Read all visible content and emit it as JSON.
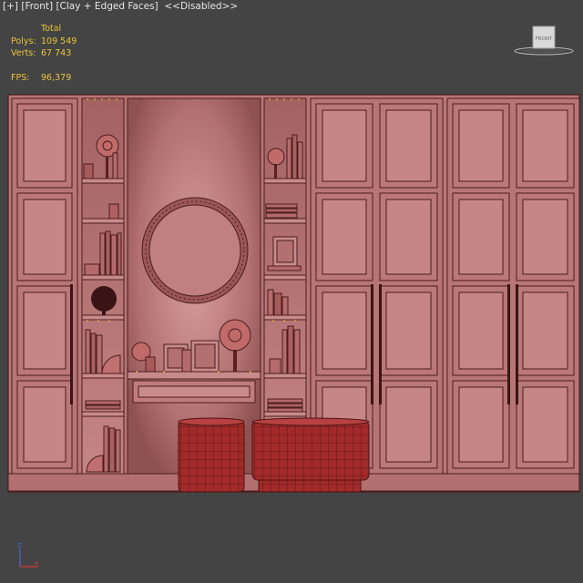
{
  "viewport": {
    "label_plus": "[+]",
    "label_view": "[Front]",
    "label_shading": "[Clay + Edged Faces]",
    "label_disabled": "<<Disabled>>"
  },
  "stats": {
    "total_label": "Total",
    "polys_label": "Polys:",
    "polys_value": "109 549",
    "verts_label": "Verts:",
    "verts_value": "67 743",
    "fps_label": "FPS:",
    "fps_value": "96,379"
  },
  "viewcube": {
    "face_label": "FRONT"
  },
  "axis": {
    "z_label": "Z",
    "x_label": "x"
  },
  "colors": {
    "background": "#444444",
    "stats_text": "#e8c33a",
    "clay": "#b06a6a",
    "edge": "#4a1d1d",
    "pouf": "#a32a2a"
  }
}
